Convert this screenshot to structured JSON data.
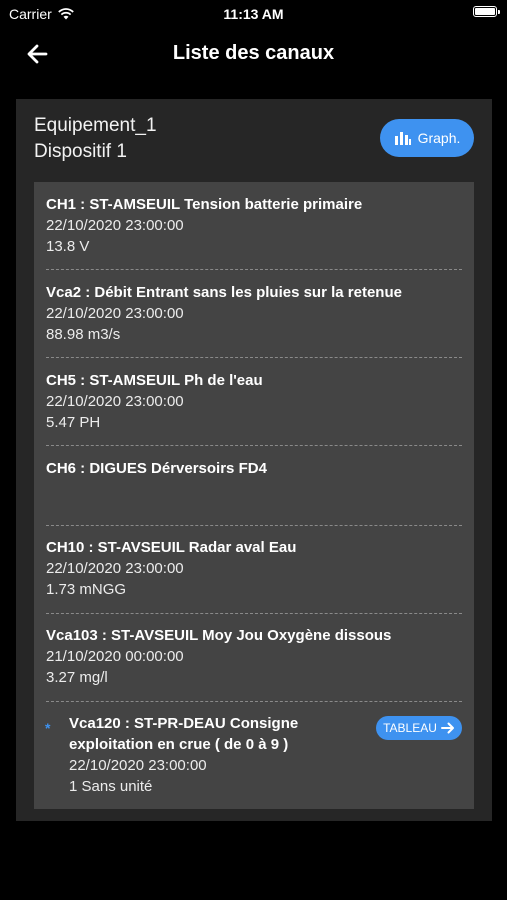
{
  "status_bar": {
    "carrier": "Carrier",
    "time": "11:13 AM",
    "wifi_icon": "wifi-icon",
    "battery_icon": "battery-icon"
  },
  "nav": {
    "title": "Liste des canaux",
    "back_icon": "arrow-left-icon"
  },
  "device": {
    "equipment": "Equipement_1",
    "name": "Dispositif 1",
    "graph_button": "Graph.",
    "graph_icon": "bar-chart-icon"
  },
  "channels": [
    {
      "title": "CH1 : ST-AMSEUIL Tension batterie primaire",
      "date": "22/10/2020 23:00:00",
      "value": "13.8 V"
    },
    {
      "title": "Vca2 : Débit Entrant sans les pluies sur la retenue",
      "date": "22/10/2020 23:00:00",
      "value": "88.98 m3/s"
    },
    {
      "title": "CH5 : ST-AMSEUIL Ph de l'eau",
      "date": "22/10/2020 23:00:00",
      "value": "5.47 PH"
    },
    {
      "title": "CH6 : DIGUES Dérversoirs FD4",
      "date": "",
      "value": ""
    },
    {
      "title": "CH10 : ST-AVSEUIL Radar aval Eau",
      "date": "22/10/2020 23:00:00",
      "value": "1.73 mNGG"
    },
    {
      "title": "Vca103 : ST-AVSEUIL Moy Jou Oxygène dissous",
      "date": "21/10/2020 00:00:00",
      "value": "3.27 mg/l"
    },
    {
      "title_line1": "Vca120 : ST-PR-DEAU Consigne",
      "title_line2": "exploitation en crue ( de 0 à 9 )",
      "date": "22/10/2020 23:00:00",
      "value": "1 Sans unité",
      "button": "TABLEAU",
      "marker": "*"
    }
  ],
  "colors": {
    "accent": "#3e92f0",
    "card": "#262626",
    "list": "#444444",
    "background": "#000000"
  }
}
